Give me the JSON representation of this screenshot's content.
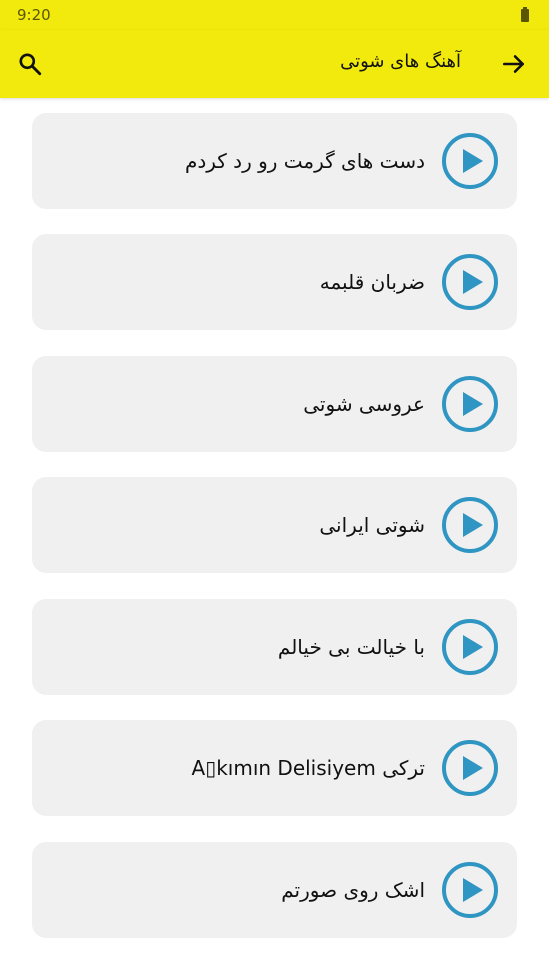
{
  "status_bar": {
    "time": "9:20",
    "battery_icon": "battery-icon"
  },
  "app_bar": {
    "title": "آهنگ های شوتی",
    "back_icon": "arrow-right-icon",
    "search_icon": "search-icon"
  },
  "colors": {
    "accent": "#f2ea0c",
    "card_bg": "#f0f0f0",
    "play_ring": "#2f95c2",
    "play_fill": "#2f95c2"
  },
  "songs": [
    {
      "title": "دست های گرمت رو رد کردم"
    },
    {
      "title": "ضربان قلبمه"
    },
    {
      "title": "عروسی شوتی"
    },
    {
      "title": "شوتی ایرانی"
    },
    {
      "title": "با خیالت بی خیالم"
    },
    {
      "title": "ترکی A▯kımın Delisiyem"
    },
    {
      "title": "اشک روی صورتم"
    }
  ]
}
